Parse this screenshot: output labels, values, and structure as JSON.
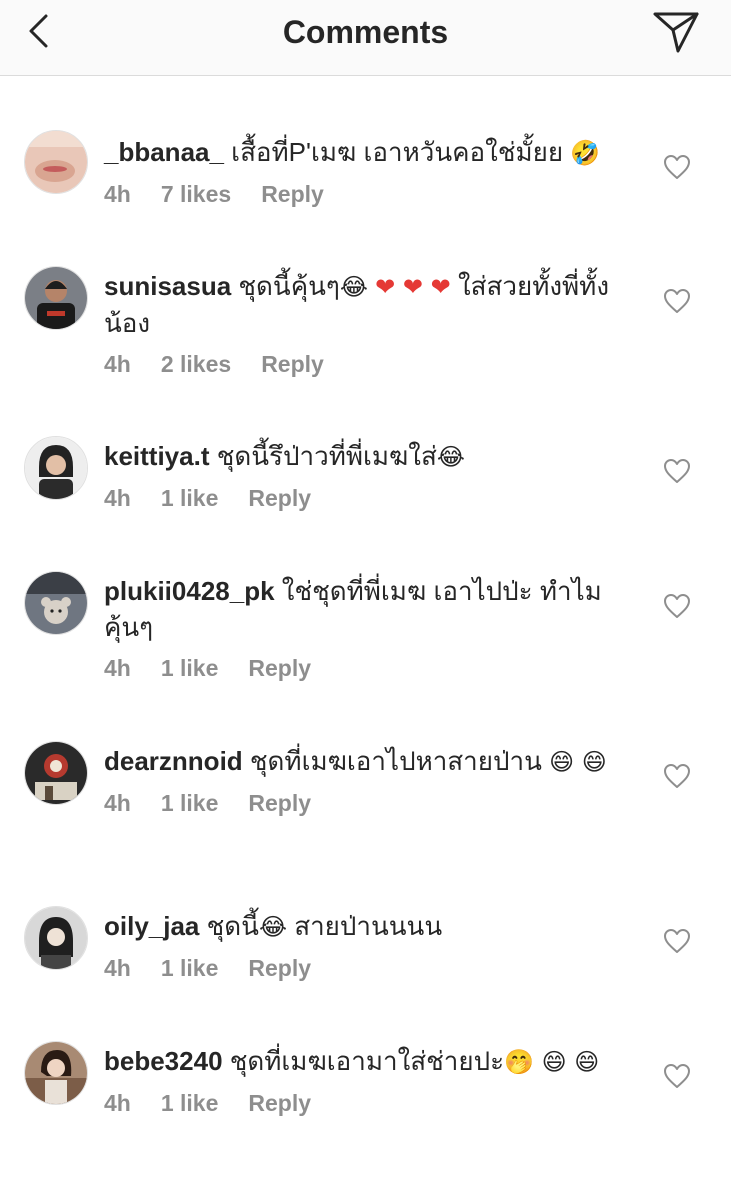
{
  "header": {
    "title": "Comments"
  },
  "comments": [
    {
      "username": "_bbanaa_",
      "text": " เสื้อที่P'เมฆ เอาหวันคอใช่มั้ยย",
      "emoji": "🤣",
      "time": "4h",
      "likes": "7 likes",
      "reply": "Reply"
    },
    {
      "username": "sunisasua",
      "text": " ชุดนี้คุ้นๆ",
      "emoji": "😂",
      "hearts": "❤ ❤ ❤",
      "text2": " ใส่สวยทั้งพี่ทั้งน้อง",
      "time": "4h",
      "likes": "2 likes",
      "reply": "Reply"
    },
    {
      "username": "keittiya.t",
      "text": " ชุดนี้รึป่าวที่พี่เมฆใส่",
      "emoji": "😂",
      "time": "4h",
      "likes": "1 like",
      "reply": "Reply"
    },
    {
      "username": "plukii0428_pk",
      "text": " ใช่ชุดที่พี่เมฆ เอาไปป่ะ ทำไมคุ้นๆ",
      "time": "4h",
      "likes": "1 like",
      "reply": "Reply"
    },
    {
      "username": "dearznnoid",
      "text": " ชุดที่เมฆเอาไปหาสายป่าน ",
      "emoji": "😄 😄",
      "time": "4h",
      "likes": "1 like",
      "reply": "Reply"
    },
    {
      "username": "oily_jaa",
      "text": " ชุดนี้",
      "emoji": "😂",
      "text2": " สายป่านนนน",
      "time": "4h",
      "likes": "1 like",
      "reply": "Reply"
    },
    {
      "username": "bebe3240",
      "text": " ชุดที่เมฆเอามาใส่ช่ายปะ",
      "emoji": "🤭 😄 😄",
      "time": "4h",
      "likes": "1 like",
      "reply": "Reply"
    }
  ],
  "icons": {
    "back": "chevron-left-icon",
    "send": "send-icon",
    "heart": "heart-outline-icon"
  },
  "colors": {
    "header_bg": "#fafafa",
    "text": "#262626",
    "meta": "#8e8e8e",
    "divider": "#dbdbdb"
  }
}
